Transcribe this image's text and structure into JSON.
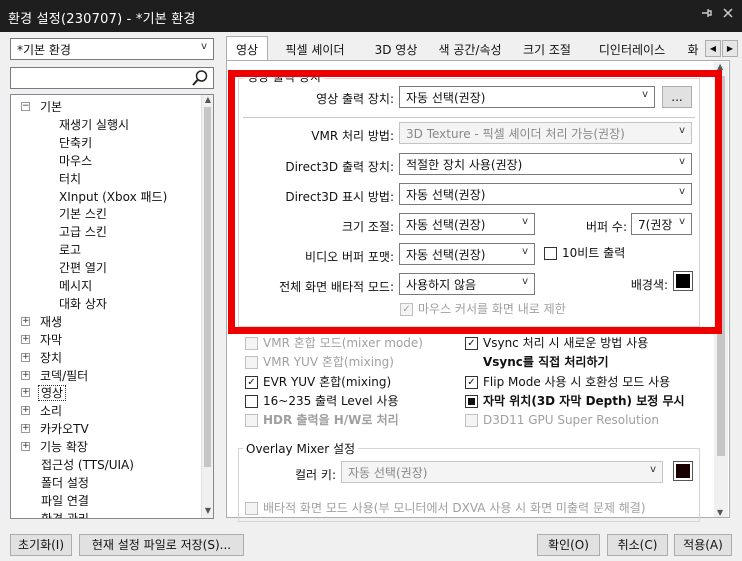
{
  "window": {
    "title": "환경 설정(230707) - *기본 환경",
    "pin_icon": "pin-icon",
    "close_icon": "close-icon"
  },
  "left": {
    "profile": "*기본 환경",
    "search_value": "",
    "tree": [
      {
        "label": "기본",
        "exp": "−"
      },
      {
        "label": "재생기 실행시"
      },
      {
        "label": "단축키"
      },
      {
        "label": "마우스"
      },
      {
        "label": "터치"
      },
      {
        "label": "XInput (Xbox 패드)"
      },
      {
        "label": "기본 스킨"
      },
      {
        "label": "고급 스킨"
      },
      {
        "label": "로고"
      },
      {
        "label": "간편 열기"
      },
      {
        "label": "메시지"
      },
      {
        "label": "대화 상자"
      },
      {
        "label": "재생",
        "exp": "+"
      },
      {
        "label": "자막",
        "exp": "+"
      },
      {
        "label": "장치",
        "exp": "+"
      },
      {
        "label": "코덱/필터",
        "exp": "+"
      },
      {
        "label": "영상",
        "exp": "+",
        "selected": true
      },
      {
        "label": "소리",
        "exp": "+"
      },
      {
        "label": "카카오TV",
        "exp": "+"
      },
      {
        "label": "기능 확장",
        "exp": "+"
      },
      {
        "label": "접근성 (TTS/UIA)"
      },
      {
        "label": "폴더 설정"
      },
      {
        "label": "파일 연결"
      },
      {
        "label": "환경 관리"
      }
    ]
  },
  "tabs": [
    "영상",
    "픽셀 셰이더",
    "3D 영상",
    "색 공간/속성",
    "크기 조절",
    "디인터레이스",
    "화"
  ],
  "video_device": {
    "group_label": "영상 출력 장치",
    "output_device_label": "영상 출력 장치:",
    "output_device_value": "자동 선택(권장)",
    "more_button": "...",
    "vmr_method_label": "VMR 처리 방법:",
    "vmr_method_value": "3D Texture - 픽셀 셰이더 처리 가능(권장)",
    "d3d_output_label": "Direct3D 출력 장치:",
    "d3d_output_value": "적절한 장치 사용(권장)",
    "d3d_display_label": "Direct3D 표시 방법:",
    "d3d_display_value": "자동 선택(권장)",
    "resize_label": "크기 조절:",
    "resize_value": "자동 선택(권장)",
    "buffer_label": "버퍼 수:",
    "buffer_value": "7(권장",
    "video_buffer_label": "비디오 버퍼 포맷:",
    "video_buffer_value": "자동 선택(권장)",
    "tenbit_label": "10비트 출력",
    "fullscreen_label": "전체 화면 배타적 모드:",
    "fullscreen_value": "사용하지 않음",
    "bg_color_label": "배경색:",
    "mouse_cursor_label": "마우스 커서를 화면 내로 제한"
  },
  "options": {
    "vmr_mix": "VMR 혼합 모드(mixer mode)",
    "vmr_yuv": "VMR YUV 혼합(mixing)",
    "evr_yuv": "EVR YUV 혼합(mixing)",
    "level_16_235": "16~235 출력 Level 사용",
    "hdr": "HDR 출력을 H/W로 처리",
    "vsync_new": "Vsync 처리 시 새로운 방법 사용",
    "vsync_direct": "Vsync를 직접 처리하기",
    "flip_mode": "Flip Mode 사용 시 호환성 모드 사용",
    "subtitle_depth": "자막 위치(3D 자막 Depth) 보정 무시",
    "d3d11_sr": "D3D11 GPU Super Resolution"
  },
  "overlay": {
    "group_label": "Overlay Mixer 설정",
    "color_key_label": "컬러 키:",
    "color_key_value": "자동 선택(권장)",
    "exclusive_label": "배타적 화면 모드 사용(부 모니터에서 DXVA 사용 시 화면 미출력 문제 해결)"
  },
  "buttons": {
    "reset": "초기화(I)",
    "save_as": "현재 설정 파일로 저장(S)...",
    "ok": "확인(O)",
    "cancel": "취소(C)",
    "apply": "적용(A)"
  },
  "colors": {
    "highlight": "#ee0000",
    "titlebar": "#1e1e1e",
    "bg_color": "#000000",
    "color_key": "#1a0000"
  }
}
